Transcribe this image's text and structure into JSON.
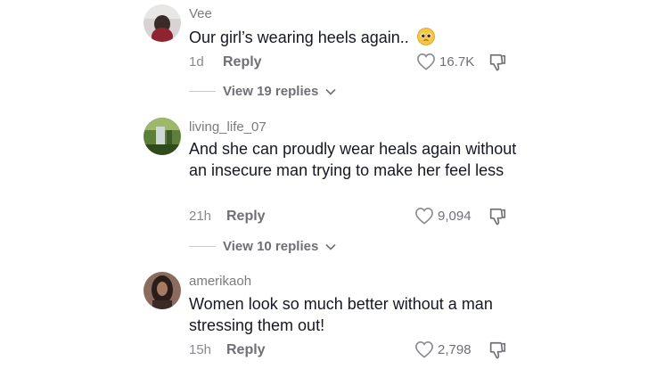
{
  "comments": [
    {
      "username": "Vee",
      "text": "Our girl’s wearing heels again..",
      "emoji": "pleading-face",
      "age": "1d",
      "reply_label": "Reply",
      "likes": "16.7K",
      "view_replies": "View 19 replies"
    },
    {
      "username": "living_life_07",
      "text": "And she can proudly wear heals again without an insecure man trying to make her feel less",
      "age": "21h",
      "reply_label": "Reply",
      "likes": "9,094",
      "view_replies": "View 10 replies"
    },
    {
      "username": "amerikaoh",
      "text": "Women look so much better without a man stressing them out!",
      "age": "15h",
      "reply_label": "Reply",
      "likes": "2,798"
    }
  ],
  "icons": {
    "like": "heart-outline-icon",
    "dislike": "thumbs-down-icon",
    "expand": "chevron-down-icon"
  }
}
